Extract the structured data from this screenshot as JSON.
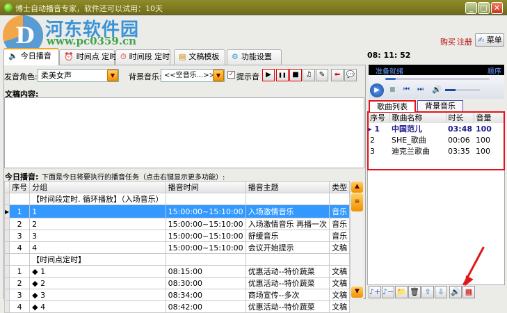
{
  "window": {
    "title": "博士自动播音专家，软件还可以试用：10天",
    "minimize": "_",
    "maximize": "□",
    "close": "✕"
  },
  "watermark": {
    "logo_text": "D",
    "title": "河东软件园",
    "url": "www.pc0359.cn"
  },
  "header": {
    "buy": "购买",
    "register": "注册",
    "menu": "菜单",
    "clock": "08: 11: 52"
  },
  "tabs": [
    {
      "label": "今日播音",
      "icon": "🔈"
    },
    {
      "label": "时间点 定时",
      "icon": "⏰"
    },
    {
      "label": "时间段 定时",
      "icon": "⏱"
    },
    {
      "label": "文稿模板",
      "icon": "▤"
    },
    {
      "label": "功能设置",
      "icon": "⚙"
    }
  ],
  "controls": {
    "voice_label": "发音角色:",
    "voice_value": "柔美女声",
    "bg_label": "背景音乐:",
    "bg_value": "<<空音乐...>>",
    "prompt_label": "提示音",
    "prompt_checked": true,
    "content_label": "文稿内容:"
  },
  "toolbar_icons": [
    "▶",
    "❚❚",
    "■",
    "♫",
    "✎",
    "⬅",
    "💬"
  ],
  "today": {
    "label": "今日播音:",
    "desc": "下面是今日将要执行的播音任务（点击右键显示更多功能）:",
    "columns": [
      "序号",
      "分组",
      "播音时间",
      "播音主题",
      "类型"
    ],
    "rows": [
      {
        "no": "",
        "group": "【时间段定时. 循环播放】（入场音乐）",
        "time": "",
        "topic": "",
        "type": "",
        "kind": "group"
      },
      {
        "no": "1",
        "group": "1",
        "time": "15:00:00~15:10:00",
        "topic": "入场激情音乐",
        "type": "音乐",
        "kind": "selected"
      },
      {
        "no": "2",
        "group": "2",
        "time": "15:00:00~15:10:00",
        "topic": "入场激情音乐 再播一次",
        "type": "音乐"
      },
      {
        "no": "3",
        "group": "3",
        "time": "15:00:00~15:10:00",
        "topic": "舒缓音乐",
        "type": "音乐"
      },
      {
        "no": "4",
        "group": "4",
        "time": "15:00:00~15:10:00",
        "topic": "会议开始提示",
        "type": "文稿"
      },
      {
        "no": "",
        "group": "【时间点定时】",
        "time": "",
        "topic": "",
        "type": "",
        "kind": "group"
      },
      {
        "no": "1",
        "group": "◆ 1",
        "time": "08:15:00",
        "topic": "优惠活动--特价蔬菜",
        "type": "文稿"
      },
      {
        "no": "2",
        "group": "◆ 2",
        "time": "08:30:00",
        "topic": "优惠活动--特价蔬菜",
        "type": "文稿"
      },
      {
        "no": "3",
        "group": "◆ 3",
        "time": "08:34:00",
        "topic": "商场宣传--多次",
        "type": "文稿"
      },
      {
        "no": "4",
        "group": "◆ 4",
        "time": "08:42:00",
        "topic": "优惠活动--特价蔬菜",
        "type": "文稿"
      }
    ]
  },
  "player": {
    "status": "准备就绪",
    "mode": "顺序",
    "progress": 0.1,
    "volume": 0.3
  },
  "song_tabs": [
    "歌曲列表",
    "背景音乐"
  ],
  "songs": {
    "columns": [
      "序号",
      "歌曲名称",
      "时长",
      "音量"
    ],
    "rows": [
      {
        "no": "1",
        "name": "中国范儿",
        "dur": "03:48",
        "vol": "100",
        "current": true
      },
      {
        "no": "2",
        "name": "SHE_歌曲",
        "dur": "00:06",
        "vol": "100"
      },
      {
        "no": "3",
        "name": "迪克兰歌曲",
        "dur": "03:35",
        "vol": "100"
      }
    ]
  },
  "bottom_icons": [
    "♪+",
    "♪−",
    "📁",
    "🗑",
    "⇧",
    "⇩",
    "🔊",
    "▦"
  ]
}
